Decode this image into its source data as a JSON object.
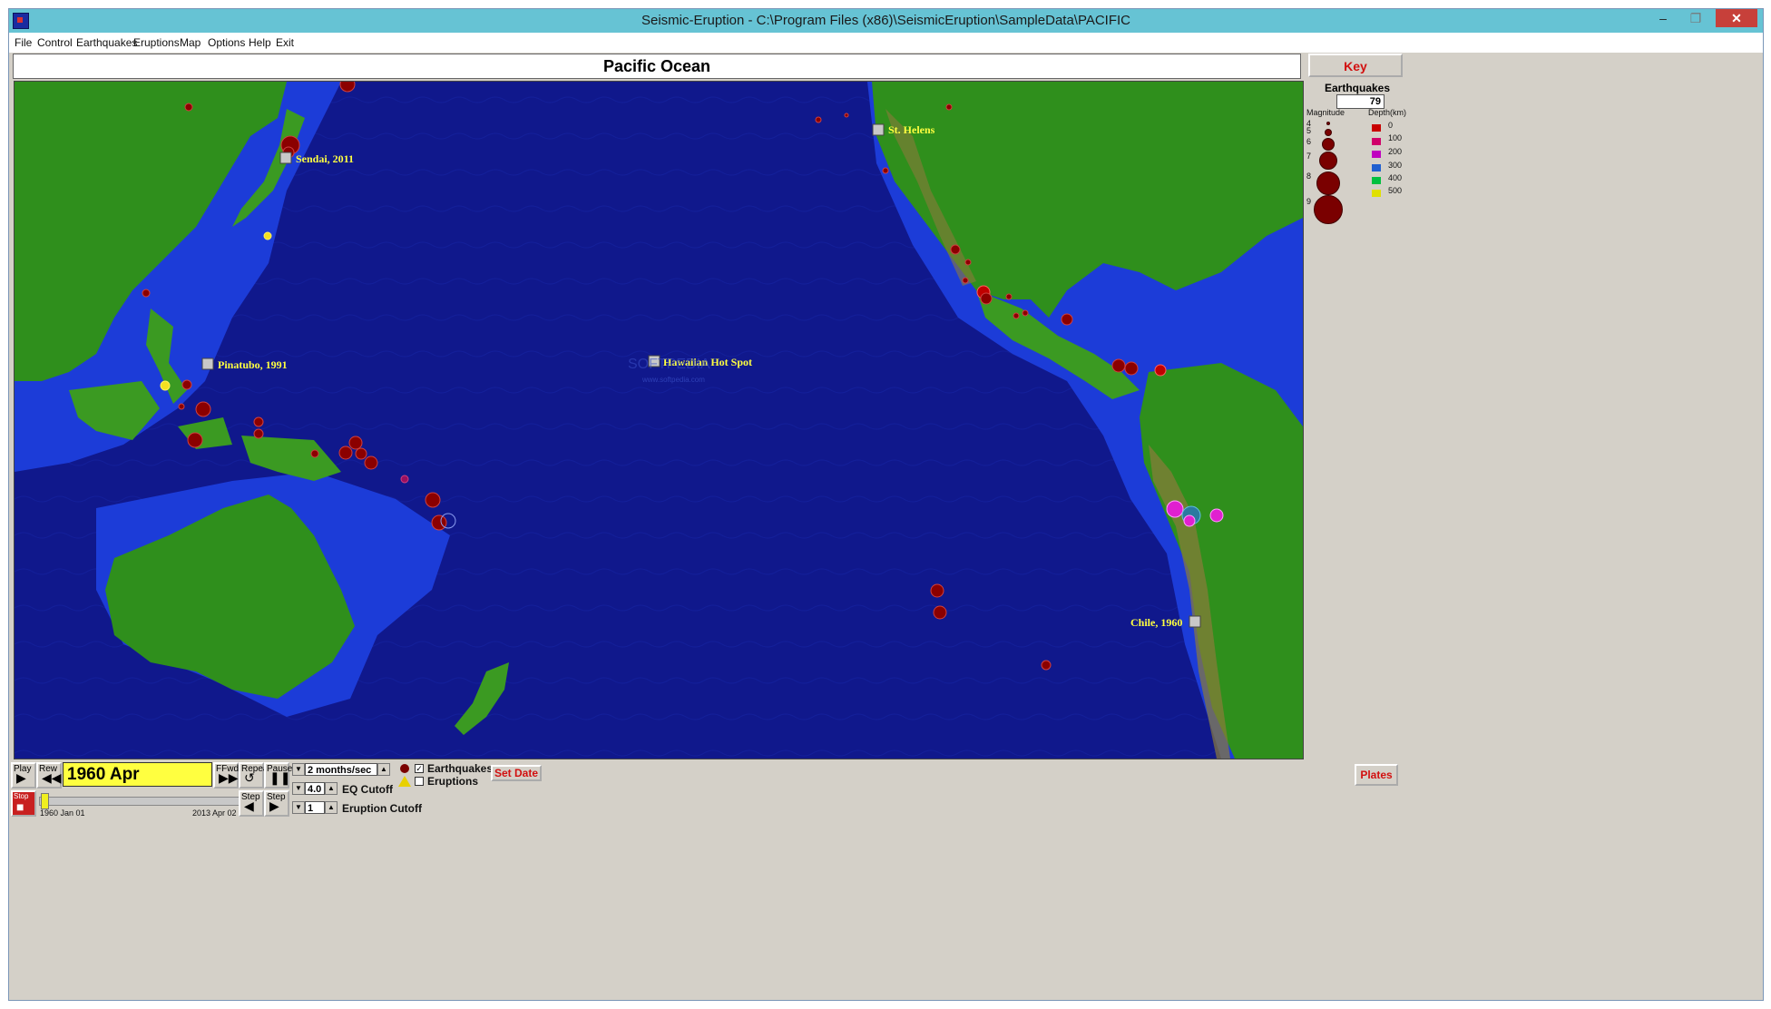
{
  "window": {
    "title": "Seismic-Eruption - C:\\Program Files (x86)\\SeismicEruption\\SampleData\\PACIFIC",
    "minimize": "–",
    "restore": "❐",
    "close": "✕"
  },
  "menu": [
    "File",
    "Control",
    "Earthquakes",
    "Eruptions",
    "Map",
    "Options",
    "Help",
    "Exit"
  ],
  "map": {
    "title": "Pacific Ocean",
    "labels": [
      "Sendai, 2011",
      "Pinatubo, 1991",
      "Hawaiian Hot Spot",
      "St. Helens",
      "Chile, 1960"
    ],
    "watermark_main": "SOFTPEDIA",
    "watermark_url": "www.softpedia.com",
    "colors": {
      "ocean_deep": "#10188c",
      "ocean_shelf": "#1c3cd8",
      "land": "#2f8f1c",
      "quake": "#8b0000"
    }
  },
  "key": {
    "button": "Key",
    "title": "Earthquakes",
    "count": "79",
    "magnitude_label": "Magnitude",
    "depth_label": "Depth(km)",
    "magnitudes": [
      "4",
      "5",
      "6",
      "7",
      "8",
      "9"
    ],
    "depths": [
      "0",
      "100",
      "200",
      "300",
      "400",
      "500"
    ],
    "depth_colors": [
      "#c80000",
      "#d0006a",
      "#c000c0",
      "#2060d0",
      "#00c040",
      "#e0e000"
    ]
  },
  "controls": {
    "play": "Play",
    "rew": "Rew",
    "date": "1960 Apr",
    "ffwd": "FFwd",
    "repeat": "Repeat",
    "pause": "Pause",
    "step_back": "Step",
    "step_fwd": "Step",
    "stop": "Stop",
    "range_start": "1960 Jan 01",
    "range_end": "2013 Apr 02",
    "slider_progress": 0.01,
    "speed": "2 months/sec",
    "eq_cutoff_value": "4.0",
    "eq_cutoff_label": "EQ Cutoff",
    "eruption_cutoff_value": "1",
    "eruption_cutoff_label": "Eruption Cutoff",
    "earthquakes_label": "Earthquakes",
    "earthquakes_checked": true,
    "eruptions_label": "Eruptions",
    "eruptions_checked": false,
    "set_date": "Set Date",
    "plates": "Plates"
  }
}
